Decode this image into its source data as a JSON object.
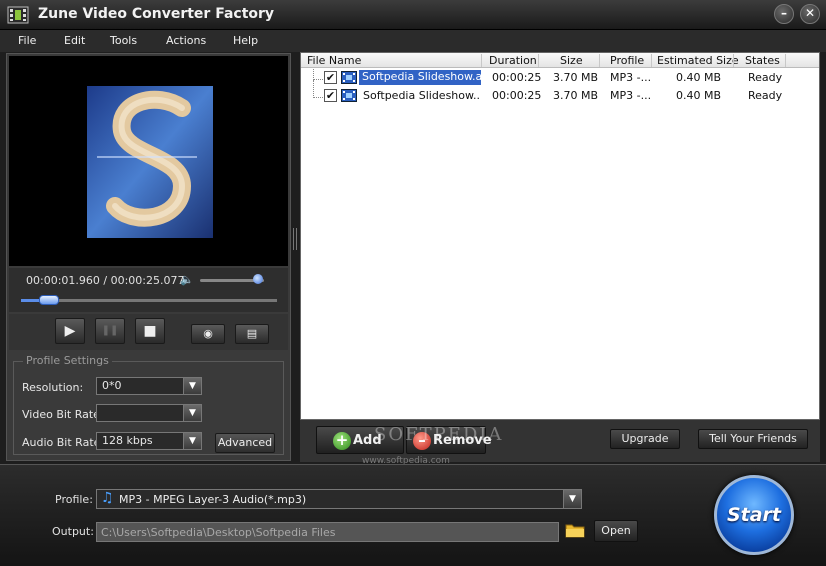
{
  "window": {
    "title": "Zune Video Converter Factory",
    "minimize_label": "–",
    "close_label": "✕"
  },
  "menu": [
    "File",
    "Edit",
    "Tools",
    "Actions",
    "Help"
  ],
  "player": {
    "time": "00:00:01.960 / 00:00:25.077",
    "volume_fraction": 0.9,
    "seek_fraction": 0.08,
    "play_glyph": "▶",
    "pause_glyph": "❚❚",
    "stop_glyph": "■",
    "snapshot_glyph": "◉",
    "folder_glyph": "▤",
    "volume_glyph": "🔈"
  },
  "profile_settings": {
    "legend": "Profile Settings",
    "resolution_label": "Resolution:",
    "resolution_value": "0*0",
    "video_bitrate_label": "Video Bit Rate:",
    "video_bitrate_value": "",
    "audio_bitrate_label": "Audio Bit Rate:",
    "audio_bitrate_value": "128 kbps",
    "advanced_label": "Advanced"
  },
  "filelist": {
    "columns": [
      "File Name",
      "Duration",
      "Size",
      "Profile",
      "Estimated Size",
      "States"
    ],
    "rows": [
      {
        "name": "Softpedia Slideshow.avi",
        "duration": "00:00:25",
        "size": "3.70 MB",
        "profile": "MP3 -...",
        "est_size": "0.40 MB",
        "state": "Ready",
        "checked": "✔",
        "selected": true
      },
      {
        "name": "Softpedia Slideshow....",
        "duration": "00:00:25",
        "size": "3.70 MB",
        "profile": "MP3 -...",
        "est_size": "0.40 MB",
        "state": "Ready",
        "checked": "✔",
        "selected": false
      }
    ]
  },
  "list_actions": {
    "add_label": "Add",
    "add_glyph": "+",
    "remove_label": "Remove",
    "remove_glyph": "–",
    "upgrade_label": "Upgrade",
    "tell_label": "Tell Your Friends"
  },
  "watermark": {
    "small": "www.softpedia.com",
    "big": "SOFTPEDIA"
  },
  "output": {
    "profile_label": "Profile:",
    "profile_value": "MP3 - MPEG Layer-3 Audio(*.mp3)",
    "profile_glyph": "♫",
    "output_label": "Output:",
    "output_value": "C:\\Users\\Softpedia\\Desktop\\Softpedia Files",
    "open_label": "Open",
    "start_label": "Start"
  },
  "colors": {
    "accent": "#3163c5",
    "background": "#1e1e1e",
    "start_blue": "#1e6fe0"
  }
}
